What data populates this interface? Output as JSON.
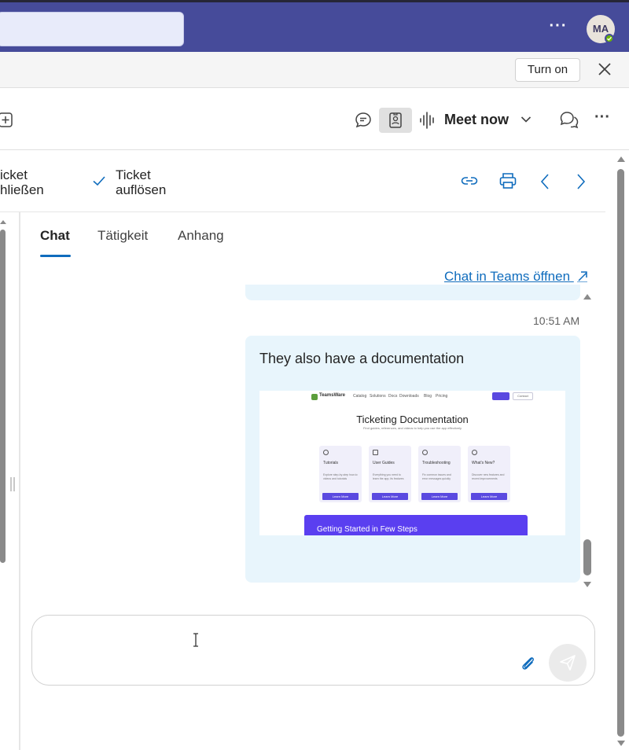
{
  "titlebar": {
    "search_placeholder": "",
    "more_icon": "more-horizontal-icon",
    "avatar_initials": "MA",
    "presence_color": "#6bb700",
    "brand_color": "#464b9a"
  },
  "notification": {
    "turn_on_label": "Turn on",
    "close_icon": "close-icon"
  },
  "toolbar": {
    "meet_now_label": "Meet now"
  },
  "commands": {
    "close_ticket_line1": "icket",
    "close_ticket_line2": "hließen",
    "resolve_ticket_line1": "Ticket",
    "resolve_ticket_line2": "auflösen"
  },
  "tabs": [
    {
      "label": "Chat",
      "active": true
    },
    {
      "label": "Tätigkeit",
      "active": false
    },
    {
      "label": "Anhang",
      "active": false
    }
  ],
  "chat": {
    "open_in_teams_label": "Chat in Teams öffnen",
    "timestamp": "10:51 AM",
    "message_text": "They also have a documentation",
    "preview": {
      "logo_text": "TeamsWare",
      "nav_items": [
        "Catalog",
        "Solutions",
        "Docs",
        "Downloads",
        "Blog",
        "Pricing"
      ],
      "contact_label": "Contact",
      "title": "Ticketing Documentation",
      "subtitle": "Find guides, references, and videos to help you use the app effectively",
      "cards": [
        {
          "title": "Tutorials",
          "desc": "Explore step-by-step how-to videos and tutorials",
          "button": "Learn More"
        },
        {
          "title": "User Guides",
          "desc": "Everything you need to learn the app, its features",
          "button": "Learn More"
        },
        {
          "title": "Troubleshooting",
          "desc": "Fix common issues and error messages quickly",
          "button": "Learn More"
        },
        {
          "title": "What's New?",
          "desc": "Discover new features and recent improvements",
          "button": "Learn More"
        }
      ],
      "banner_text": "Getting Started in Few Steps"
    }
  },
  "composer": {
    "placeholder": "",
    "attach_icon": "paperclip-icon",
    "send_icon": "send-icon"
  },
  "colors": {
    "accent": "#0f6cbd",
    "bubble": "#e8f5fc",
    "preview_purple": "#5a49e0"
  }
}
